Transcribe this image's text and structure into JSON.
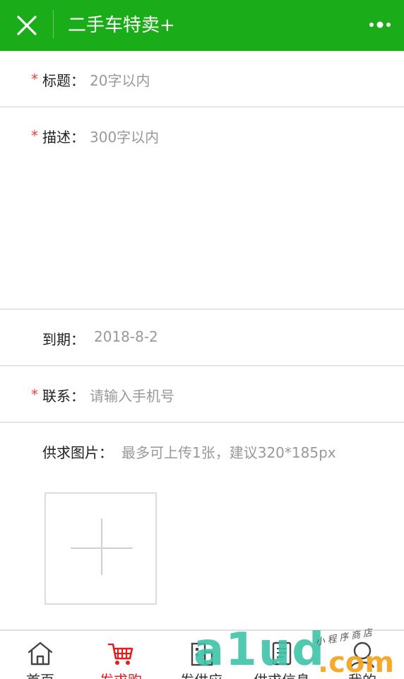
{
  "header": {
    "title": "二手车特卖+",
    "bg_color": "#1aad19",
    "close_icon": "close-icon",
    "more_icon": "more-dots-icon"
  },
  "form": {
    "required_mark": "*",
    "title_row": {
      "label": "标题：",
      "placeholder": "20字以内"
    },
    "desc_row": {
      "label": "描述：",
      "placeholder": "300字以内"
    },
    "expire_row": {
      "label": "到期：",
      "value": "2018-8-2"
    },
    "contact_row": {
      "label": "联系：",
      "placeholder": "请输入手机号"
    },
    "images_row": {
      "label": "供求图片：",
      "hint": "最多可上传1张，建议320*185px",
      "upload_icon": "plus-icon"
    }
  },
  "tabbar": {
    "active_color": "#e02020",
    "tabs": [
      {
        "label": "首页",
        "icon": "home-icon",
        "active": false
      },
      {
        "label": "发求购",
        "icon": "cart-icon",
        "active": true
      },
      {
        "label": "发供应",
        "icon": "building-icon",
        "active": false
      },
      {
        "label": "供求信息",
        "icon": "document-icon",
        "active": false
      },
      {
        "label": "我的",
        "icon": "user-icon",
        "active": false
      }
    ]
  },
  "watermark": {
    "main": "a1ud",
    "suffix": ".com",
    "small": "小程序商店"
  }
}
